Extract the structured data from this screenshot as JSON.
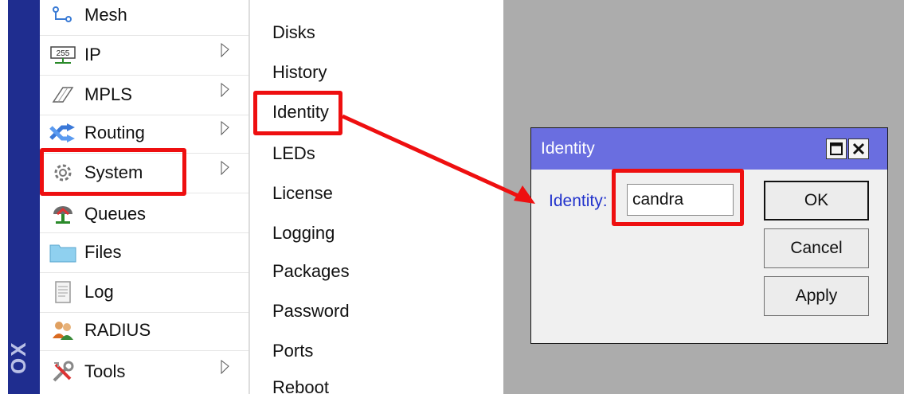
{
  "sidebar_brand": "OX",
  "main_menu": {
    "items": [
      {
        "label": "Mesh",
        "icon": "mesh-icon",
        "submenu": false
      },
      {
        "label": "IP",
        "icon": "ip-icon",
        "submenu": true
      },
      {
        "label": "MPLS",
        "icon": "mpls-icon",
        "submenu": true
      },
      {
        "label": "Routing",
        "icon": "routing-icon",
        "submenu": true
      },
      {
        "label": "System",
        "icon": "system-icon",
        "submenu": true
      },
      {
        "label": "Queues",
        "icon": "queues-icon",
        "submenu": false
      },
      {
        "label": "Files",
        "icon": "files-icon",
        "submenu": false
      },
      {
        "label": "Log",
        "icon": "log-icon",
        "submenu": false
      },
      {
        "label": "RADIUS",
        "icon": "radius-icon",
        "submenu": false
      },
      {
        "label": "Tools",
        "icon": "tools-icon",
        "submenu": true
      }
    ],
    "ip_icon_text": "255"
  },
  "system_submenu": {
    "items": [
      "Disks",
      "History",
      "Identity",
      "LEDs",
      "License",
      "Logging",
      "Packages",
      "Password",
      "Ports",
      "Reboot"
    ]
  },
  "identity_dialog": {
    "title": "Identity",
    "field_label": "Identity:",
    "field_value": "candra",
    "buttons": {
      "ok": "OK",
      "cancel": "Cancel",
      "apply": "Apply"
    }
  },
  "colors": {
    "highlight": "#ee0f10",
    "title_bar": "#6a6ee0",
    "label_blue": "#2233cc",
    "sidebar": "#1f2d8f"
  }
}
